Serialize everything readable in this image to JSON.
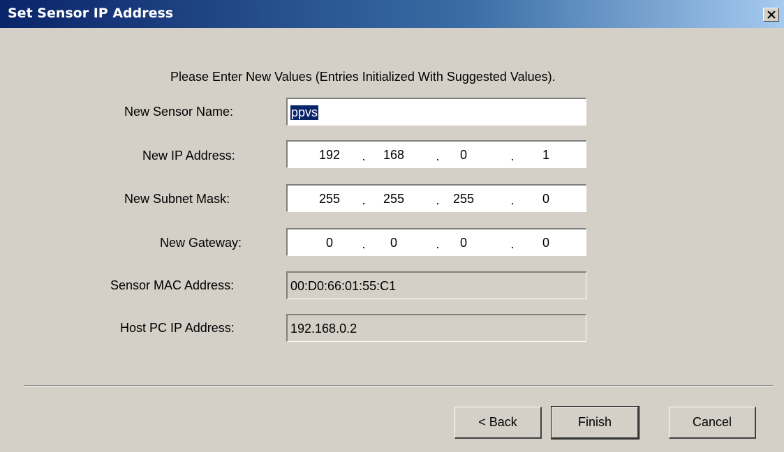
{
  "window": {
    "title": "Set Sensor IP Address"
  },
  "instructions": "Please Enter New Values (Entries Initialized With Suggested Values).",
  "form": {
    "sensor_name": {
      "label": "New Sensor Name:",
      "value": "ppvs"
    },
    "ip_address": {
      "label": "New IP Address:",
      "octets": [
        "192",
        "168",
        "0",
        "1"
      ]
    },
    "subnet_mask": {
      "label": "New Subnet Mask:",
      "octets": [
        "255",
        "255",
        "255",
        "0"
      ]
    },
    "gateway": {
      "label": "New Gateway:",
      "octets": [
        "0",
        "0",
        "0",
        "0"
      ]
    },
    "mac_address": {
      "label": "Sensor MAC Address:",
      "value": "00:D0:66:01:55:C1"
    },
    "host_ip": {
      "label": "Host PC IP Address:",
      "value": "192.168.0.2"
    },
    "ip_separator": "."
  },
  "buttons": {
    "back": "< Back",
    "finish": "Finish",
    "cancel": "Cancel"
  },
  "icons": {
    "close": "close-icon"
  },
  "colors": {
    "title_start": "#0a246a",
    "title_end": "#a6caf0",
    "face": "#d4d0c8",
    "selection": "#0a246a"
  }
}
